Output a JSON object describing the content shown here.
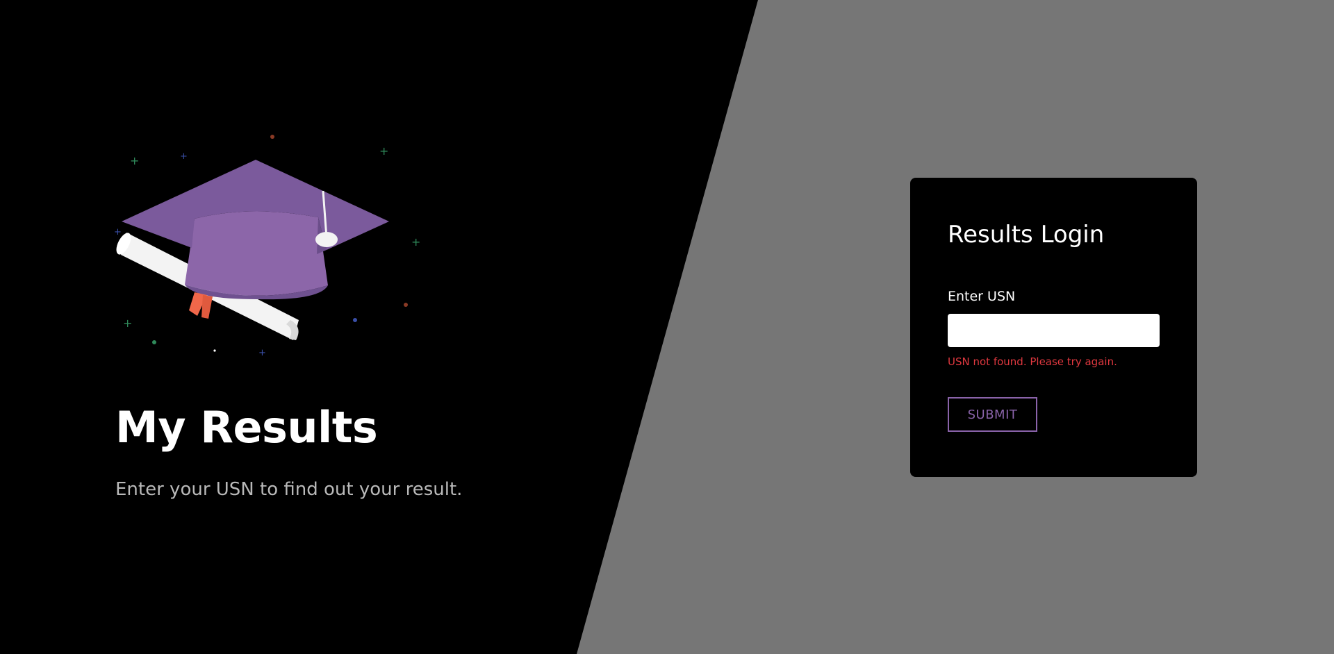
{
  "hero": {
    "title": "My Results",
    "subtitle": "Enter your USN to find out your result."
  },
  "illustration": {
    "icon": "graduation-cap-with-diploma-icon",
    "colors": {
      "cap": "#7b5a9c",
      "cap_band": "#8c66a9",
      "diploma": "#f3f3f3",
      "ribbon": "#f0674a",
      "tassel": "#f3f3f3"
    }
  },
  "login": {
    "title": "Results Login",
    "usn_label": "Enter USN",
    "usn_value": "",
    "usn_placeholder": "",
    "error_message": "USN not found. Please try again.",
    "submit_label": "SUBMIT"
  },
  "theme": {
    "background_left": "#000000",
    "background_right": "#767676",
    "accent": "#8a63aa",
    "error": "#e0383f"
  }
}
